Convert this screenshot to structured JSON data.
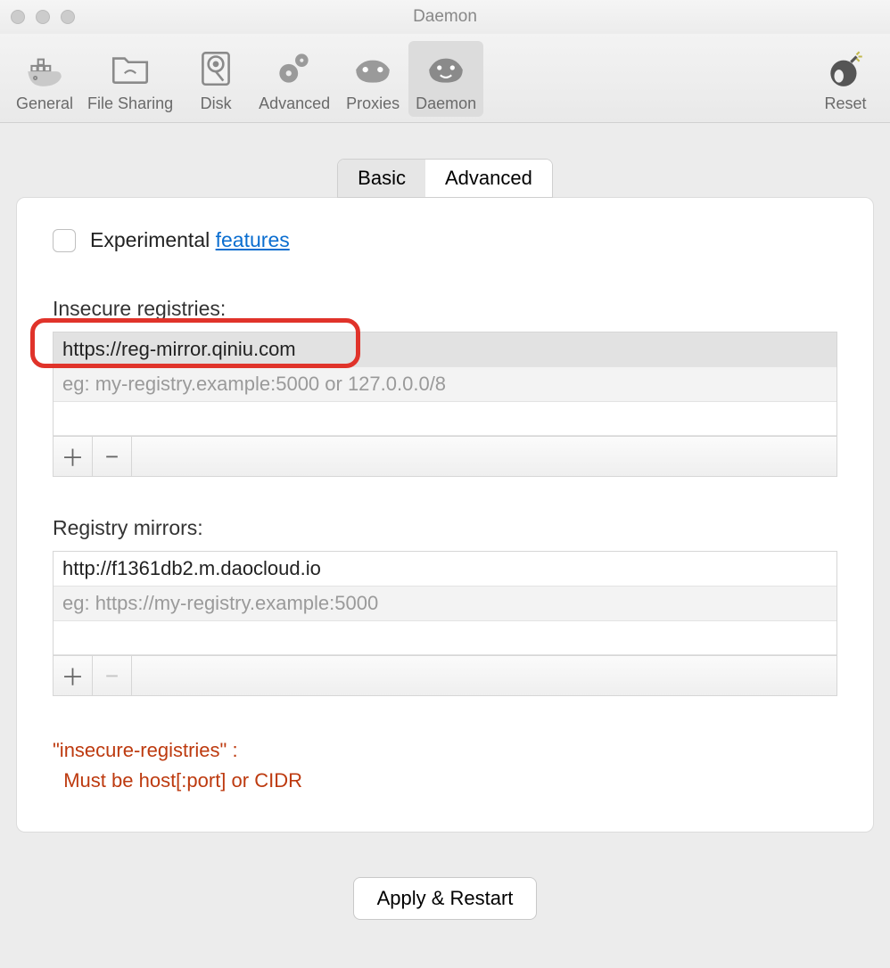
{
  "window": {
    "title": "Daemon"
  },
  "toolbar": {
    "items": [
      {
        "label": "General"
      },
      {
        "label": "File Sharing"
      },
      {
        "label": "Disk"
      },
      {
        "label": "Advanced"
      },
      {
        "label": "Proxies"
      },
      {
        "label": "Daemon"
      }
    ],
    "reset_label": "Reset"
  },
  "subtabs": {
    "basic": "Basic",
    "advanced": "Advanced"
  },
  "experimental": {
    "label_part1": "Experimental ",
    "link": "features"
  },
  "insecure": {
    "label": "Insecure registries:",
    "entries": [
      "https://reg-mirror.qiniu.com"
    ],
    "placeholder": "eg: my-registry.example:5000 or 127.0.0.0/8"
  },
  "mirrors": {
    "label": "Registry mirrors:",
    "entries": [
      "http://f1361db2.m.daocloud.io"
    ],
    "placeholder": "eg: https://my-registry.example:5000"
  },
  "error": {
    "line1": "\"insecure-registries\" :",
    "line2": "  Must be host[:port] or CIDR"
  },
  "apply_label": "Apply & Restart",
  "glyphs": {
    "plus": "＋",
    "minus": "−"
  }
}
